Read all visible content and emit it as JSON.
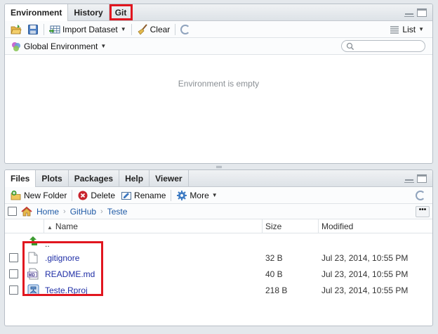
{
  "top_pane": {
    "tabs": [
      {
        "label": "Environment",
        "active": true
      },
      {
        "label": "History",
        "active": false
      },
      {
        "label": "Git",
        "active": false,
        "highlighted": true
      }
    ],
    "toolbar": {
      "open_icon": "open-folder-icon",
      "save_icon": "save-icon",
      "import_label": "Import Dataset",
      "clear_label": "Clear",
      "refresh_icon": "refresh-icon",
      "list_label": "List"
    },
    "env_selector": "Global Environment",
    "search_placeholder": "",
    "empty_message": "Environment is empty"
  },
  "bottom_pane": {
    "tabs": [
      {
        "label": "Files",
        "active": true
      },
      {
        "label": "Plots",
        "active": false
      },
      {
        "label": "Packages",
        "active": false
      },
      {
        "label": "Help",
        "active": false
      },
      {
        "label": "Viewer",
        "active": false
      }
    ],
    "toolbar": {
      "new_folder_label": "New Folder",
      "delete_label": "Delete",
      "rename_label": "Rename",
      "more_label": "More"
    },
    "breadcrumb": [
      "Home",
      "GitHub",
      "Teste"
    ],
    "more_btn": "•••",
    "columns": {
      "name": "Name",
      "sort_indicator": "▲",
      "size": "Size",
      "modified": "Modified"
    },
    "parent_row": "..",
    "files": [
      {
        "name": ".gitignore",
        "size": "32 B",
        "modified": "Jul 23, 2014, 10:55 PM",
        "icon": "text-file-icon"
      },
      {
        "name": "README.md",
        "size": "40 B",
        "modified": "Jul 23, 2014, 10:55 PM",
        "icon": "markdown-file-icon"
      },
      {
        "name": "Teste.Rproj",
        "size": "218 B",
        "modified": "Jul 23, 2014, 10:55 PM",
        "icon": "rproj-file-icon"
      }
    ]
  },
  "colors": {
    "highlight": "#e1161f",
    "link": "#1f5aa6",
    "file_link": "#1f2ea6"
  }
}
